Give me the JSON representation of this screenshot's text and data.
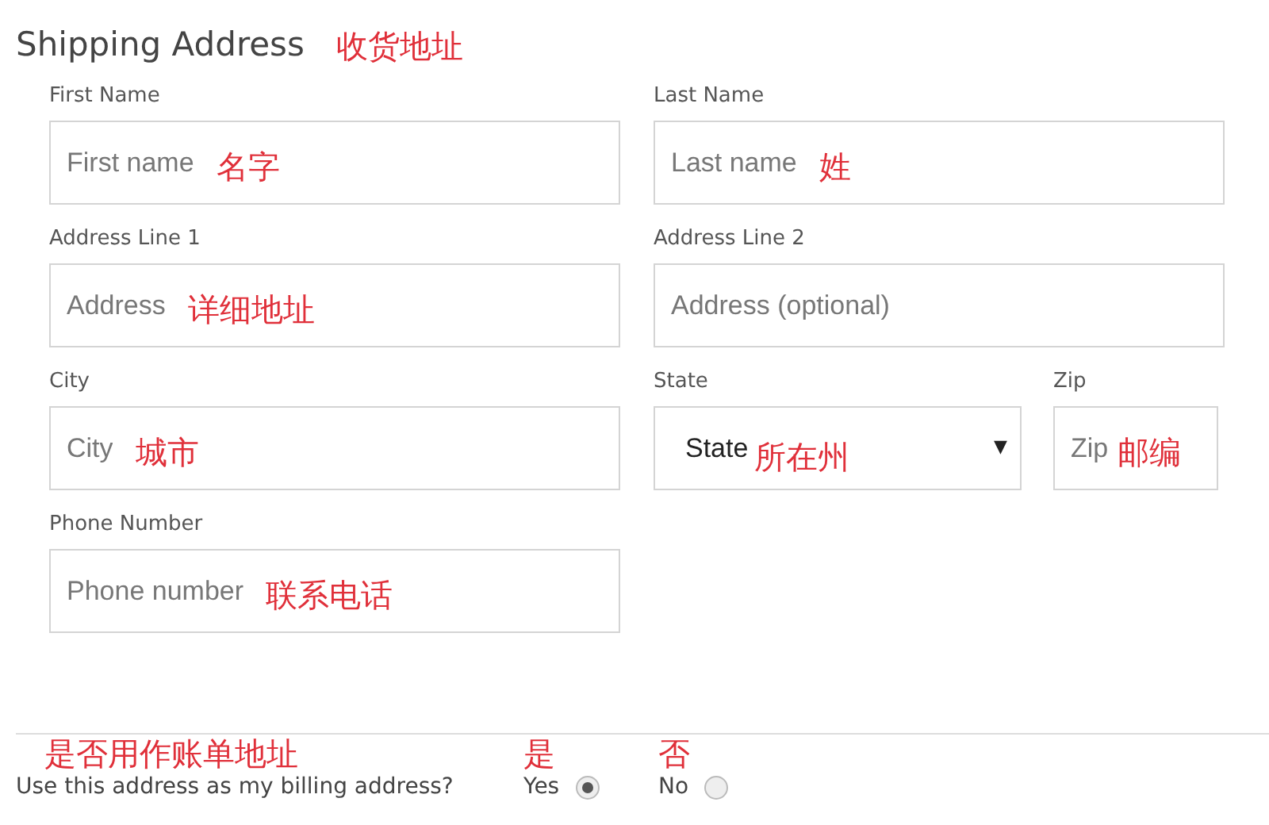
{
  "heading": {
    "title": "Shipping Address",
    "note": "收货地址"
  },
  "rows": [
    [
      {
        "kind": "text",
        "label": "First Name",
        "placeholder": "First name",
        "note": "名字"
      },
      {
        "kind": "text",
        "label": "Last Name",
        "placeholder": "Last name",
        "note": "姓"
      }
    ],
    [
      {
        "kind": "text",
        "label": "Address Line 1",
        "placeholder": "Address",
        "note": "详细地址"
      },
      {
        "kind": "text",
        "label": "Address Line 2",
        "placeholder": "Address (optional)"
      }
    ],
    [
      {
        "kind": "text",
        "label": "City",
        "placeholder": "City",
        "note": "城市"
      },
      {
        "kind": "select",
        "label": "State",
        "value": "State",
        "caret": "▼",
        "note": "所在州"
      },
      {
        "kind": "zip",
        "label": "Zip",
        "placeholder": "Zip",
        "note": "邮编"
      }
    ],
    [
      {
        "kind": "text",
        "label": "Phone Number",
        "placeholder": "Phone number",
        "note": "联系电话"
      }
    ]
  ],
  "billing": {
    "note": "是否用作账单地址",
    "question": "Use this address as my billing address?",
    "options": [
      {
        "label": "Yes",
        "note": "是",
        "selected": true
      },
      {
        "label": "No",
        "note": "否",
        "selected": false
      }
    ]
  }
}
